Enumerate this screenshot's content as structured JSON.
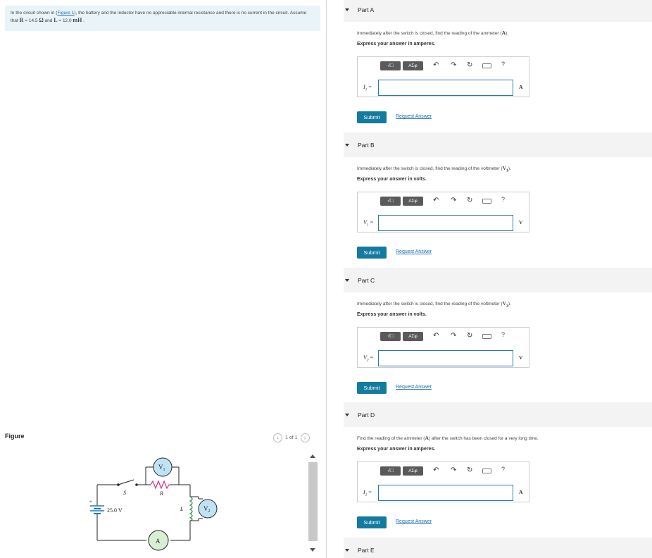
{
  "problem": {
    "text_before_link": "In the circuit shown in (",
    "link": "Figure 1",
    "text_after_link": "), the battery and the inductor have no appreciable internal resistance and there is no current in the circuit. Assume that ",
    "r_sym": "R",
    "r_val": " = 14.5 ",
    "r_unit": "Ω",
    "and": " and ",
    "l_sym": "L",
    "l_val": " = 12.0 ",
    "l_unit": "mH",
    "end": " ."
  },
  "figure": {
    "label": "Figure",
    "pager": "1 of 1",
    "prev_icon": "chevron-left-icon",
    "next_icon": "chevron-right-icon",
    "circuit": {
      "battery": "25.0 V",
      "switch": "S",
      "resistor": "R",
      "inductor": "L",
      "voltmeter1": "V",
      "voltmeter1_sub": "1",
      "voltmeter2": "V",
      "voltmeter2_sub": "2",
      "ammeter": "A",
      "plus": "+"
    }
  },
  "toolbar": {
    "templates_label": "√□",
    "symbols_label": "ΑΣφ",
    "help": "?",
    "undo_icon": "undo-icon",
    "redo_icon": "redo-icon",
    "reset_icon": "reset-icon",
    "keyboard_icon": "keyboard-icon"
  },
  "parts": [
    {
      "title": "Part A",
      "question": "Immediately after the switch is closed, find the reading of the ammeter (",
      "question_sym": "A",
      "question_end": ").",
      "express": "Express your answer in amperes.",
      "var": "I",
      "var_sub": "1",
      "eq": " =",
      "unit": "A",
      "submit": "Submit",
      "request": "Request Answer"
    },
    {
      "title": "Part B",
      "question": "Immediately after the switch is closed, find the reading of the voltmeter (",
      "question_sym": "V",
      "question_sub": "1",
      "question_end": ").",
      "express": "Express your answer in volts.",
      "var": "V",
      "var_sub": "1",
      "eq": " =",
      "unit": "V",
      "submit": "Submit",
      "request": "Request Answer"
    },
    {
      "title": "Part C",
      "question": "Immediately after the switch is closed, find the reading of the voltmeter (",
      "question_sym": "V",
      "question_sub": "2",
      "question_end": ").",
      "express": "Express your answer in volts.",
      "var": "V",
      "var_sub": "2",
      "eq": " =",
      "unit": "V",
      "submit": "Submit",
      "request": "Request Answer"
    },
    {
      "title": "Part D",
      "question": "Find the reading of the ammeter (",
      "question_sym": "A",
      "question_end": ") after the switch has been closed for a very long time.",
      "express": "Express your answer in amperes.",
      "var": "I",
      "var_sub": "2",
      "eq": " =",
      "unit": "A",
      "submit": "Submit",
      "request": "Request Answer"
    }
  ],
  "part_e": {
    "title": "Part E"
  }
}
